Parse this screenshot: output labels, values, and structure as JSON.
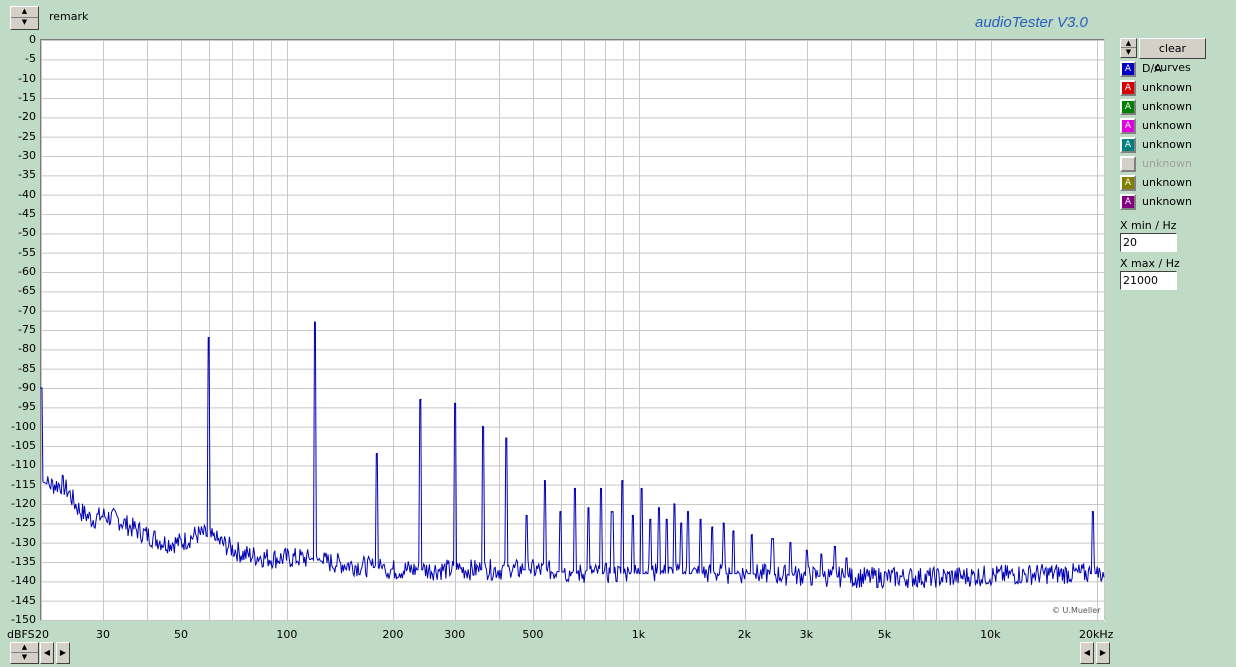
{
  "header": {
    "remark_label": "remark",
    "app_title": "audioTester  V3.0"
  },
  "controls": {
    "clear_curves_label": "clear curves",
    "x_min_label": "X min / Hz",
    "x_min_value": "20",
    "x_max_label": "X max / Hz",
    "x_max_value": "21000"
  },
  "legend": [
    {
      "label": "D/A",
      "color": "#0000c8",
      "glyph": "A"
    },
    {
      "label": "unknown",
      "color": "#d40000",
      "glyph": "A"
    },
    {
      "label": "unknown",
      "color": "#008000",
      "glyph": "A"
    },
    {
      "label": "unknown",
      "color": "#e000e0",
      "glyph": "A"
    },
    {
      "label": "unknown",
      "color": "#008080",
      "glyph": "A"
    },
    {
      "label": "unknown",
      "color": "#c0c0c0",
      "glyph": "",
      "disabled": true
    },
    {
      "label": "unknown",
      "color": "#808000",
      "glyph": "A"
    },
    {
      "label": "unknown",
      "color": "#800080",
      "glyph": "A"
    }
  ],
  "credit": "© U.Mueller",
  "icons": {
    "spin_up": "up-arrow-icon",
    "spin_down": "down-arrow-icon",
    "left": "left-arrow-icon",
    "right": "right-arrow-icon"
  },
  "chart_data": {
    "type": "line",
    "x_scale": "log",
    "xlim": [
      20,
      21000
    ],
    "ylim": [
      -150,
      0
    ],
    "grid": true,
    "ylabel": "dBFS",
    "y_ticks": [
      0,
      -5,
      -10,
      -15,
      -20,
      -25,
      -30,
      -35,
      -40,
      -45,
      -50,
      -55,
      -60,
      -65,
      -70,
      -75,
      -80,
      -85,
      -90,
      -95,
      -100,
      -105,
      -110,
      -115,
      -120,
      -125,
      -130,
      -135,
      -140,
      -145,
      -150
    ],
    "x_tick_labels": [
      {
        "value": 20,
        "label": "20"
      },
      {
        "value": 30,
        "label": "30"
      },
      {
        "value": 50,
        "label": "50"
      },
      {
        "value": 100,
        "label": "100"
      },
      {
        "value": 200,
        "label": "200"
      },
      {
        "value": 300,
        "label": "300"
      },
      {
        "value": 500,
        "label": "500"
      },
      {
        "value": 1000,
        "label": "1k"
      },
      {
        "value": 2000,
        "label": "2k"
      },
      {
        "value": 3000,
        "label": "3k"
      },
      {
        "value": 5000,
        "label": "5k"
      },
      {
        "value": 10000,
        "label": "10k"
      },
      {
        "value": 20000,
        "label": "20kHz"
      }
    ],
    "series": [
      {
        "color": "#0000b4",
        "baseline": [
          [
            20,
            -114
          ],
          [
            21,
            -115
          ],
          [
            23,
            -115
          ],
          [
            24,
            -117
          ],
          [
            25,
            -120
          ],
          [
            26,
            -122
          ],
          [
            28,
            -124
          ],
          [
            30,
            -123
          ],
          [
            33,
            -124
          ],
          [
            36,
            -126
          ],
          [
            40,
            -128
          ],
          [
            45,
            -130
          ],
          [
            50,
            -130
          ],
          [
            55,
            -128
          ],
          [
            58,
            -128
          ],
          [
            65,
            -130
          ],
          [
            75,
            -133
          ],
          [
            90,
            -134
          ],
          [
            110,
            -134
          ],
          [
            130,
            -135
          ],
          [
            160,
            -136
          ],
          [
            200,
            -137
          ],
          [
            300,
            -137
          ],
          [
            500,
            -137
          ],
          [
            700,
            -138
          ],
          [
            1000,
            -138
          ],
          [
            2000,
            -138
          ],
          [
            4000,
            -139
          ],
          [
            7000,
            -139
          ],
          [
            10000,
            -138.5
          ],
          [
            15000,
            -138
          ],
          [
            21000,
            -138
          ]
        ],
        "peaks": [
          {
            "x": 20,
            "y": -90
          },
          {
            "x": 60,
            "y": -77
          },
          {
            "x": 120,
            "y": -73
          },
          {
            "x": 180,
            "y": -107
          },
          {
            "x": 240,
            "y": -93
          },
          {
            "x": 300,
            "y": -94
          },
          {
            "x": 360,
            "y": -100
          },
          {
            "x": 420,
            "y": -103
          },
          {
            "x": 480,
            "y": -123
          },
          {
            "x": 540,
            "y": -114
          },
          {
            "x": 600,
            "y": -122
          },
          {
            "x": 660,
            "y": -116
          },
          {
            "x": 720,
            "y": -121
          },
          {
            "x": 780,
            "y": -116
          },
          {
            "x": 840,
            "y": -122
          },
          {
            "x": 900,
            "y": -114
          },
          {
            "x": 960,
            "y": -123
          },
          {
            "x": 1020,
            "y": -116
          },
          {
            "x": 1080,
            "y": -124
          },
          {
            "x": 1140,
            "y": -121
          },
          {
            "x": 1200,
            "y": -124
          },
          {
            "x": 1260,
            "y": -120
          },
          {
            "x": 1320,
            "y": -125
          },
          {
            "x": 1380,
            "y": -122
          },
          {
            "x": 1500,
            "y": -124
          },
          {
            "x": 1620,
            "y": -126
          },
          {
            "x": 1740,
            "y": -125
          },
          {
            "x": 1860,
            "y": -127
          },
          {
            "x": 2100,
            "y": -128
          },
          {
            "x": 2400,
            "y": -129
          },
          {
            "x": 2700,
            "y": -130
          },
          {
            "x": 3000,
            "y": -132
          },
          {
            "x": 3300,
            "y": -133
          },
          {
            "x": 3600,
            "y": -131
          },
          {
            "x": 3900,
            "y": -134
          },
          {
            "x": 19500,
            "y": -122
          }
        ]
      }
    ]
  }
}
